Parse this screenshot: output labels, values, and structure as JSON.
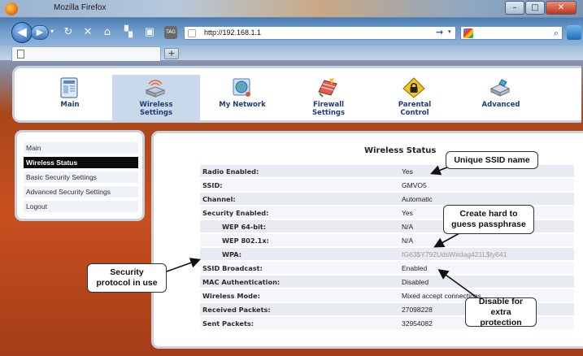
{
  "browser": {
    "window_title": "Mozilla Firefox",
    "url": "http://192.168.1.1",
    "new_tab_label": "+",
    "tag_label": "TAG"
  },
  "topnav": {
    "items": [
      {
        "label": "Main",
        "icon": "main-page-icon"
      },
      {
        "label": "Wireless\nSettings",
        "icon": "wireless-router-icon"
      },
      {
        "label": "My Network",
        "icon": "network-globe-icon"
      },
      {
        "label": "Firewall\nSettings",
        "icon": "firewall-bricks-icon"
      },
      {
        "label": "Parental\nControl",
        "icon": "padlock-icon"
      },
      {
        "label": "Advanced",
        "icon": "advanced-router-icon"
      }
    ],
    "active": "Wireless Settings"
  },
  "sidebar": {
    "items": [
      "Main",
      "Wireless Status",
      "Basic Security Settings",
      "Advanced Security Settings",
      "Logout"
    ],
    "active": "Wireless Status"
  },
  "status": {
    "title": "Wireless Status",
    "rows": [
      {
        "label": "Radio Enabled:",
        "value": "Yes"
      },
      {
        "label": "SSID:",
        "value": "GMVO5"
      },
      {
        "label": "Channel:",
        "value": "Automatic"
      },
      {
        "label": "Security Enabled:",
        "value": "Yes"
      },
      {
        "label": "WEP 64-bit:",
        "value": "N/A"
      },
      {
        "label": "WEP 802.1x:",
        "value": "N/A"
      },
      {
        "label": "WPA:",
        "value": "fG63$Y792UdsW#dag421L$ty641"
      },
      {
        "label": "SSID Broadcast:",
        "value": "Enabled"
      },
      {
        "label": "MAC Authentication:",
        "value": "Disabled"
      },
      {
        "label": "Wireless Mode:",
        "value": "Mixed accept connections"
      },
      {
        "label": "Received Packets:",
        "value": "27098228"
      },
      {
        "label": "Sent Packets:",
        "value": "32954082"
      }
    ]
  },
  "callouts": {
    "ssid": "Unique SSID name",
    "passphrase": "Create hard to guess passphrase",
    "security": "Security protocol in use",
    "broadcast": "Disable for extra protection"
  }
}
